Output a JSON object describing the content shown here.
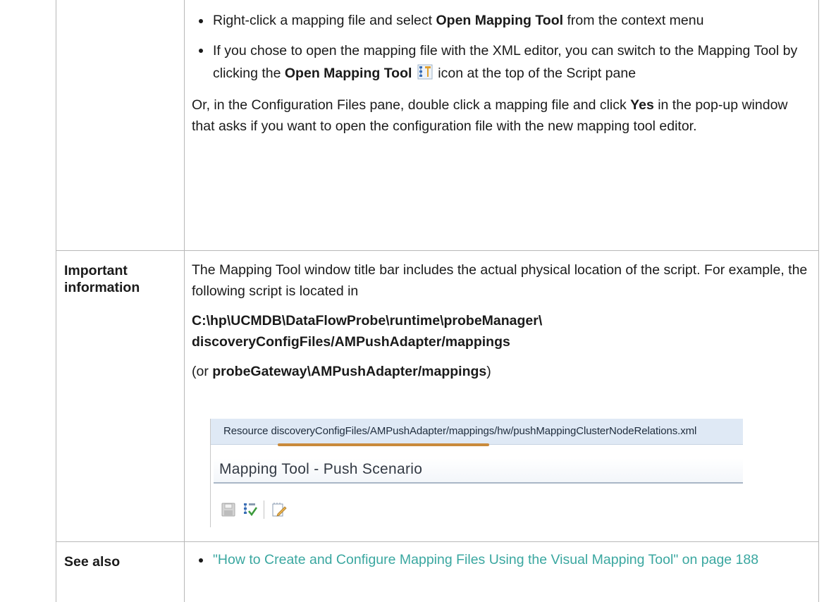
{
  "row1": {
    "bullets": [
      {
        "pre": "Right-click a mapping file and select ",
        "bold": "Open Mapping Tool",
        "post": " from the context menu"
      },
      {
        "pre": "If you chose to open the mapping file with the XML editor, you can switch to the Mapping Tool by clicking the ",
        "bold": "Open Mapping Tool",
        "post": " icon at the top of the Script pane",
        "icon": "open-mapping-tool-icon"
      }
    ],
    "para": {
      "pre": "Or, in the Configuration Files pane, double click a mapping file and click ",
      "bold": "Yes",
      "post": " in the pop-up window that asks if you want to open the configuration file with the new mapping tool editor."
    }
  },
  "row2": {
    "label": "Important information",
    "intro": "The Mapping Tool window title bar includes the actual physical location of the script. For example, the following script is located in",
    "path_line1": "C:\\hp\\UCMDB\\DataFlowProbe\\runtime\\probeManager\\",
    "path_line2": "discoveryConfigFiles/AMPushAdapter/mappings",
    "alt_open": "(or ",
    "alt_bold": "probeGateway\\AMPushAdapter/mappings",
    "alt_close": ")",
    "screenshot": {
      "resource_text": "Resource discoveryConfigFiles/AMPushAdapter/mappings/hw/pushMappingClusterNodeRelations.xml",
      "window_title": "Mapping Tool - Push Scenario",
      "toolbar_icons": [
        "save-icon",
        "open-mapping-tool-icon",
        "edit-script-icon"
      ],
      "underline_color": "#c98a3c"
    }
  },
  "row3": {
    "label": "See also",
    "link": "\"How to Create and Configure Mapping Files Using the Visual Mapping Tool\" on page 188",
    "link_color": "#3aa7a0"
  }
}
